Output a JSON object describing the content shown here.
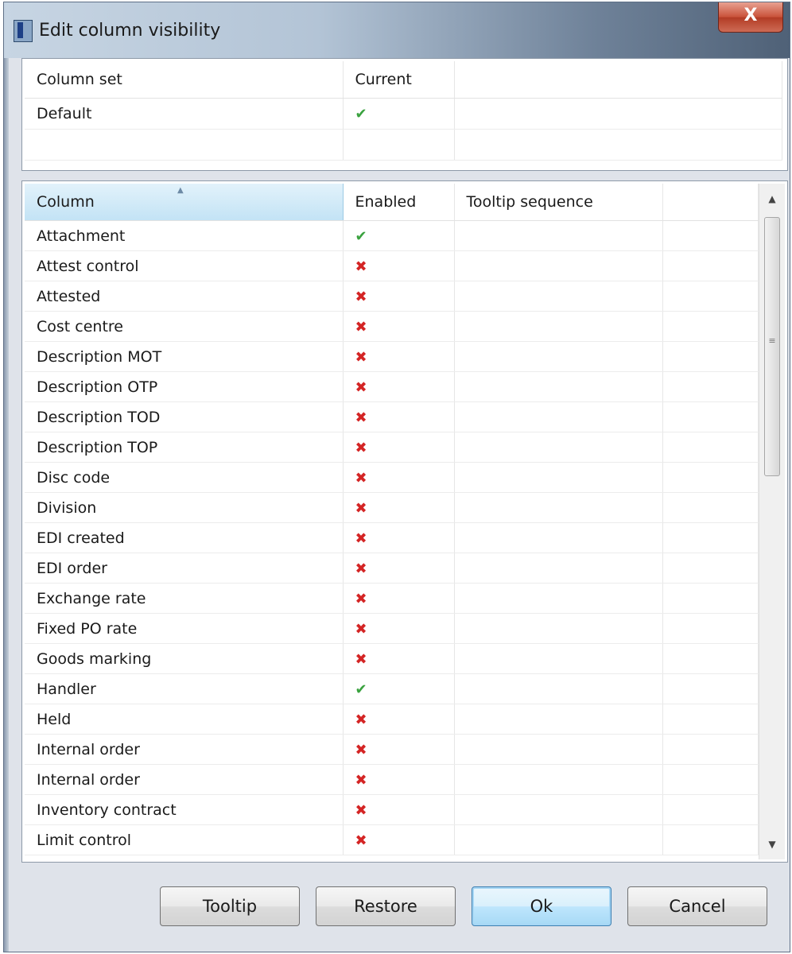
{
  "window": {
    "title": "Edit column visibility",
    "close_label": "X"
  },
  "column_sets": {
    "headers": [
      "Column set",
      "Current"
    ],
    "rows": [
      {
        "name": "Default",
        "current": true
      }
    ]
  },
  "columns": {
    "headers": [
      "Column",
      "Enabled",
      "Tooltip sequence"
    ],
    "sort_indicator": "ascending",
    "rows": [
      {
        "name": "Attachment",
        "enabled": true,
        "tooltip_sequence": ""
      },
      {
        "name": "Attest control",
        "enabled": false,
        "tooltip_sequence": ""
      },
      {
        "name": "Attested",
        "enabled": false,
        "tooltip_sequence": ""
      },
      {
        "name": "Cost centre",
        "enabled": false,
        "tooltip_sequence": ""
      },
      {
        "name": "Description MOT",
        "enabled": false,
        "tooltip_sequence": ""
      },
      {
        "name": "Description OTP",
        "enabled": false,
        "tooltip_sequence": ""
      },
      {
        "name": "Description TOD",
        "enabled": false,
        "tooltip_sequence": ""
      },
      {
        "name": "Description TOP",
        "enabled": false,
        "tooltip_sequence": ""
      },
      {
        "name": "Disc code",
        "enabled": false,
        "tooltip_sequence": ""
      },
      {
        "name": "Division",
        "enabled": false,
        "tooltip_sequence": ""
      },
      {
        "name": "EDI created",
        "enabled": false,
        "tooltip_sequence": ""
      },
      {
        "name": "EDI order",
        "enabled": false,
        "tooltip_sequence": ""
      },
      {
        "name": "Exchange rate",
        "enabled": false,
        "tooltip_sequence": ""
      },
      {
        "name": "Fixed PO rate",
        "enabled": false,
        "tooltip_sequence": ""
      },
      {
        "name": "Goods marking",
        "enabled": false,
        "tooltip_sequence": ""
      },
      {
        "name": "Handler",
        "enabled": true,
        "tooltip_sequence": ""
      },
      {
        "name": "Held",
        "enabled": false,
        "tooltip_sequence": ""
      },
      {
        "name": "Internal order",
        "enabled": false,
        "tooltip_sequence": ""
      },
      {
        "name": "Internal order",
        "enabled": false,
        "tooltip_sequence": ""
      },
      {
        "name": "Inventory contract",
        "enabled": false,
        "tooltip_sequence": ""
      },
      {
        "name": "Limit control",
        "enabled": false,
        "tooltip_sequence": ""
      }
    ]
  },
  "icons": {
    "check": "✔",
    "cross": "✖",
    "scroll_up": "▲",
    "scroll_down": "▼",
    "grip": "≡",
    "sort_asc": "▲"
  },
  "colors": {
    "check": "#3aa23f",
    "cross": "#d42424",
    "selected_header": "#c3e3f5",
    "default_button": "#bee6fd"
  },
  "buttons": {
    "tooltip": "Tooltip",
    "restore": "Restore",
    "ok": "Ok",
    "cancel": "Cancel"
  }
}
